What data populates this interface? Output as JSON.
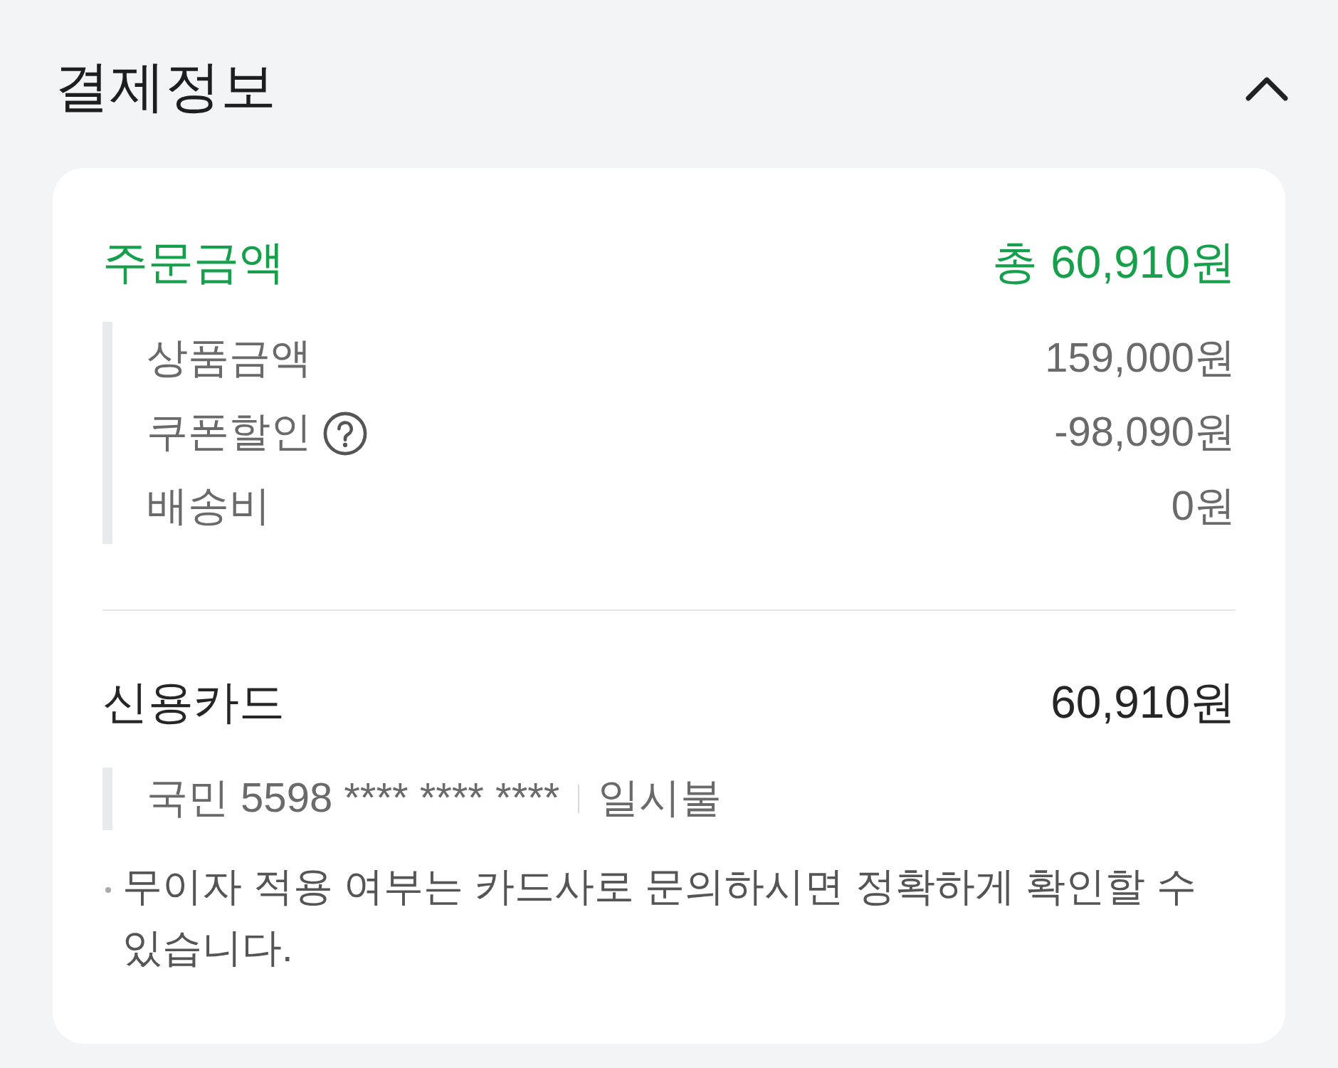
{
  "section": {
    "title": "결제정보",
    "expanded": true
  },
  "order": {
    "label": "주문금액",
    "total": "총 60,910원",
    "items": [
      {
        "label": "상품금액",
        "amount": "159,000원",
        "help": false
      },
      {
        "label": "쿠폰할인",
        "amount": "-98,090원",
        "help": true
      },
      {
        "label": "배송비",
        "amount": "0원",
        "help": false
      }
    ]
  },
  "payment": {
    "method": "신용카드",
    "amount": "60,910원",
    "card": "국민 5598 **** **** ****",
    "installment": "일시불",
    "note": "무이자 적용 여부는 카드사로 문의하시면 정확하게 확인할 수 있습니다."
  }
}
